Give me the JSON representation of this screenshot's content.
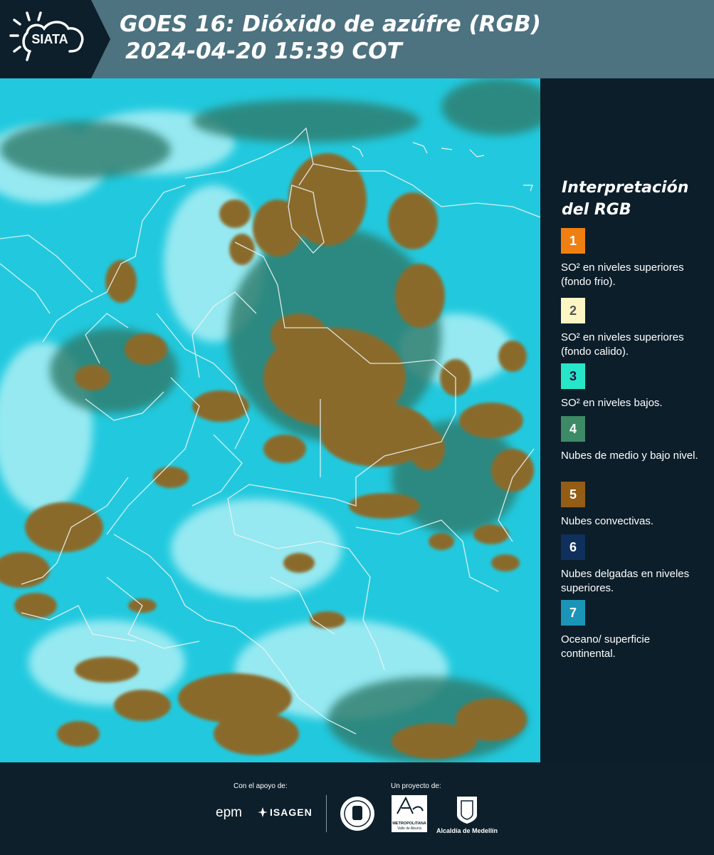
{
  "header": {
    "logo_text": "SIATA",
    "title_line1": "GOES 16: Dióxido de azúfre (RGB)",
    "title_line2": "2024-04-20 15:39 COT",
    "band_color": "#4d7280"
  },
  "map": {
    "background_color": "#22c9de",
    "convective_color": "#8a6a2c",
    "boundary_color": "#e8f4f6"
  },
  "legend": {
    "title": "Interpretación del RGB",
    "items": [
      {
        "number": "1",
        "color": "#f07f12",
        "text": "SO² en niveles superiores (fondo frio)."
      },
      {
        "number": "2",
        "color": "#fcf6c4",
        "text": "SO² en niveles superiores (fondo calido)."
      },
      {
        "number": "3",
        "color": "#27e6c8",
        "text": "SO² en niveles bajos."
      },
      {
        "number": "4",
        "color": "#3c8a66",
        "text": "Nubes de medio y bajo nivel."
      },
      {
        "number": "5",
        "color": "#935d16",
        "text": "Nubes convectivas."
      },
      {
        "number": "6",
        "color": "#0f2f5c",
        "text": "Nubes delgadas en niveles superiores."
      },
      {
        "number": "7",
        "color": "#1a95b8",
        "text": "Oceano/ superficie continental."
      }
    ]
  },
  "footer": {
    "support_label": "Con el apoyo de:",
    "project_label": "Un proyecto de:",
    "epm": "epm",
    "isagen": "ISAGEN",
    "metropolitana": "METROPOLITANA",
    "valle": "Valle de Aburrá",
    "alcaldia": "Alcaldía de Medellín"
  }
}
